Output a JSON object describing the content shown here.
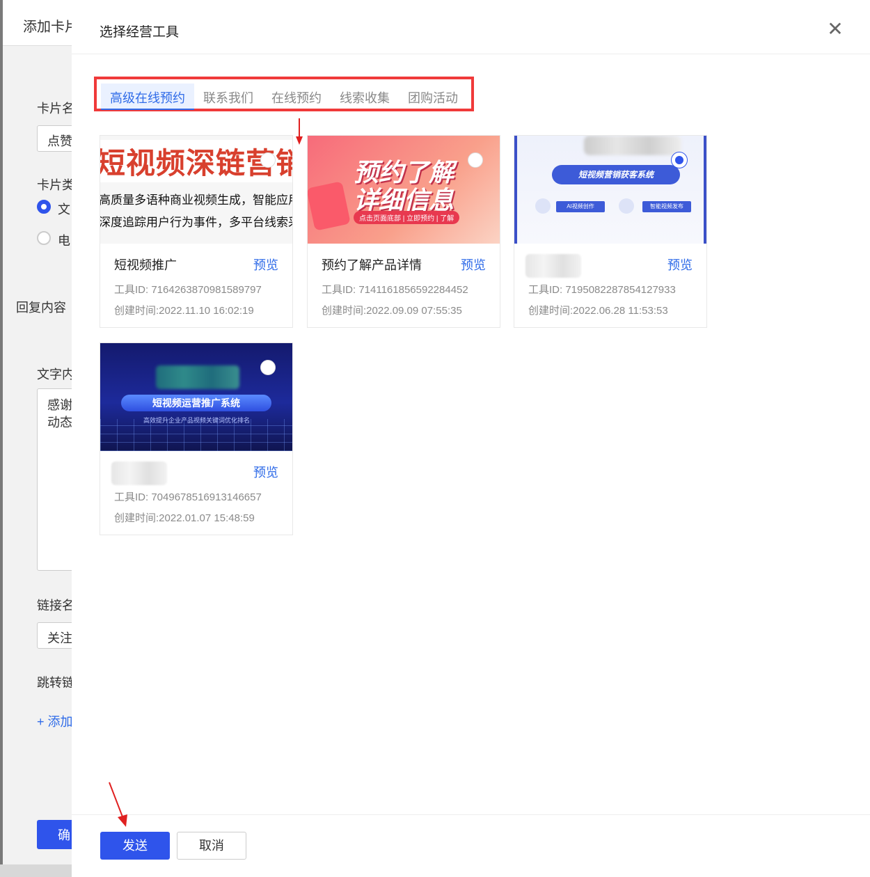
{
  "background": {
    "title": "添加卡片",
    "labels": [
      "卡片名",
      "点赞",
      "卡片类",
      "文",
      "电",
      "回复内容",
      "文字内",
      "感谢",
      "动态",
      "链接名",
      "关注",
      "跳转链",
      "+ 添加",
      "确"
    ]
  },
  "modal": {
    "title": "选择经营工具",
    "close_icon": "close-icon"
  },
  "tabs": [
    {
      "label": "高级在线预约",
      "active": true
    },
    {
      "label": "联系我们",
      "active": false
    },
    {
      "label": "在线预约",
      "active": false
    },
    {
      "label": "线索收集",
      "active": false
    },
    {
      "label": "团购活动",
      "active": false
    }
  ],
  "cards": [
    {
      "name": "短视频推广",
      "preview": "预览",
      "tool_id": "工具ID: 7164263870981589797",
      "created": "创建时间:2022.11.10 16:02:19",
      "image_text": [
        "短视频深链营销",
        "高质量多语种商业视频生成，智能应用",
        "深度追踪用户行为事件，多平台线索采"
      ]
    },
    {
      "name": "预约了解产品详情",
      "preview": "预览",
      "tool_id": "工具ID: 7141161856592284452",
      "created": "创建时间:2022.09.09 07:55:35",
      "image_text": [
        "预约了解",
        "详细信息",
        "点击页面底部 | 立即预约 | 了解"
      ]
    },
    {
      "name": "",
      "preview": "预览",
      "tool_id": "工具ID: 7195082287854127933",
      "created": "创建时间:2022.06.28 11:53:53",
      "image_text": [
        "短视频营销获客系统",
        "AI视频创作",
        "智能视频发布"
      ]
    },
    {
      "name": "",
      "preview": "预览",
      "tool_id": "工具ID: 7049678516913146657",
      "created": "创建时间:2022.01.07 15:48:59",
      "image_text": [
        "短视频运营推广系统",
        "高效提升企业产品视频关键词优化排名"
      ]
    }
  ],
  "footer": {
    "send_label": "发送",
    "cancel_label": "取消"
  },
  "colors": {
    "primary": "#2f54eb",
    "highlight_box": "#f03a3a",
    "tab_active": "#2f6be8"
  }
}
